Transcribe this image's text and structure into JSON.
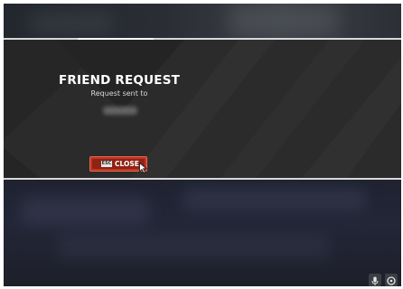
{
  "dialog": {
    "title": "FRIEND REQUEST",
    "subtitle": "Request sent to",
    "close_key": "ESC",
    "close_label": "CLOSE"
  },
  "icons": {
    "close_key": "esc-key-icon",
    "cursor": "mouse-cursor-icon",
    "mic": "microphone-icon",
    "settings": "settings-icon"
  },
  "colors": {
    "modal_bg": "#2b2b2b",
    "close_button": "#c3321f",
    "title": "#ffffff"
  }
}
